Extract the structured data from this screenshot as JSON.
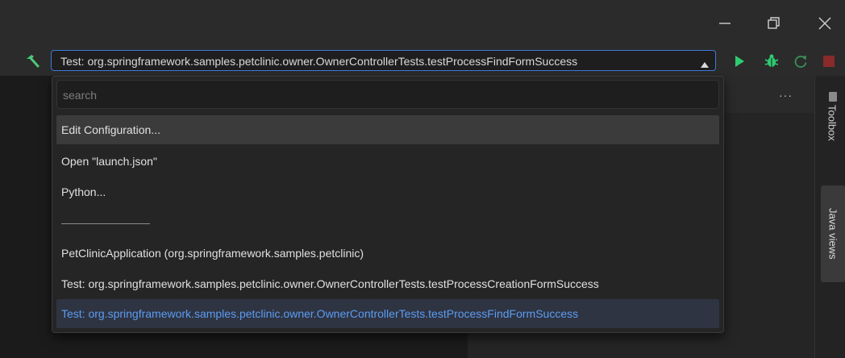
{
  "window_controls": {
    "minimize": "minimize-icon",
    "maximize": "restore-icon",
    "close": "close-icon"
  },
  "toolbar": {
    "selected_configuration": "Test: org.springframework.samples.petclinic.owner.OwnerControllerTests.testProcessFindFormSuccess",
    "build_icon": "hammer-icon",
    "run_icon": "play-icon",
    "debug_icon": "bug-icon",
    "restart_icon": "restart-icon",
    "stop_icon": "stop-icon"
  },
  "dropdown": {
    "search_placeholder": "search",
    "items": [
      {
        "label": "Edit Configuration..."
      },
      {
        "label": "Open \"launch.json\""
      },
      {
        "label": "Python..."
      },
      {
        "label": "PetClinicApplication (org.springframework.samples.petclinic)"
      },
      {
        "label": "Test: org.springframework.samples.petclinic.owner.OwnerControllerTests.testProcessCreationFormSuccess"
      },
      {
        "label": "Test: org.springframework.samples.petclinic.owner.OwnerControllerTests.testProcessFindFormSuccess"
      }
    ]
  },
  "editor": {
    "more_actions": "···"
  },
  "side_panel": {
    "tabs": [
      {
        "label": "Toolbox"
      },
      {
        "label": "Java views"
      }
    ]
  },
  "colors": {
    "accent_blue": "#3d7ad6",
    "selected_text": "#5b9cf2",
    "run_green": "#2ecc71",
    "stop_red": "#c0392b"
  }
}
